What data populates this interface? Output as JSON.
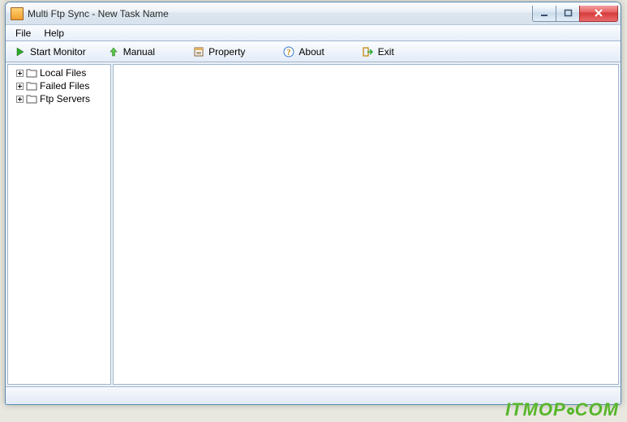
{
  "window": {
    "title": "Multi Ftp Sync - New Task Name"
  },
  "menu": {
    "file": "File",
    "help": "Help"
  },
  "toolbar": {
    "start_monitor": "Start Monitor",
    "manual": "Manual",
    "property": "Property",
    "about": "About",
    "exit": "Exit"
  },
  "tree": {
    "items": [
      {
        "label": "Local Files"
      },
      {
        "label": "Failed Files"
      },
      {
        "label": "Ftp Servers"
      }
    ]
  },
  "watermark": {
    "part1": "ITMOP",
    "part2": "COM"
  }
}
